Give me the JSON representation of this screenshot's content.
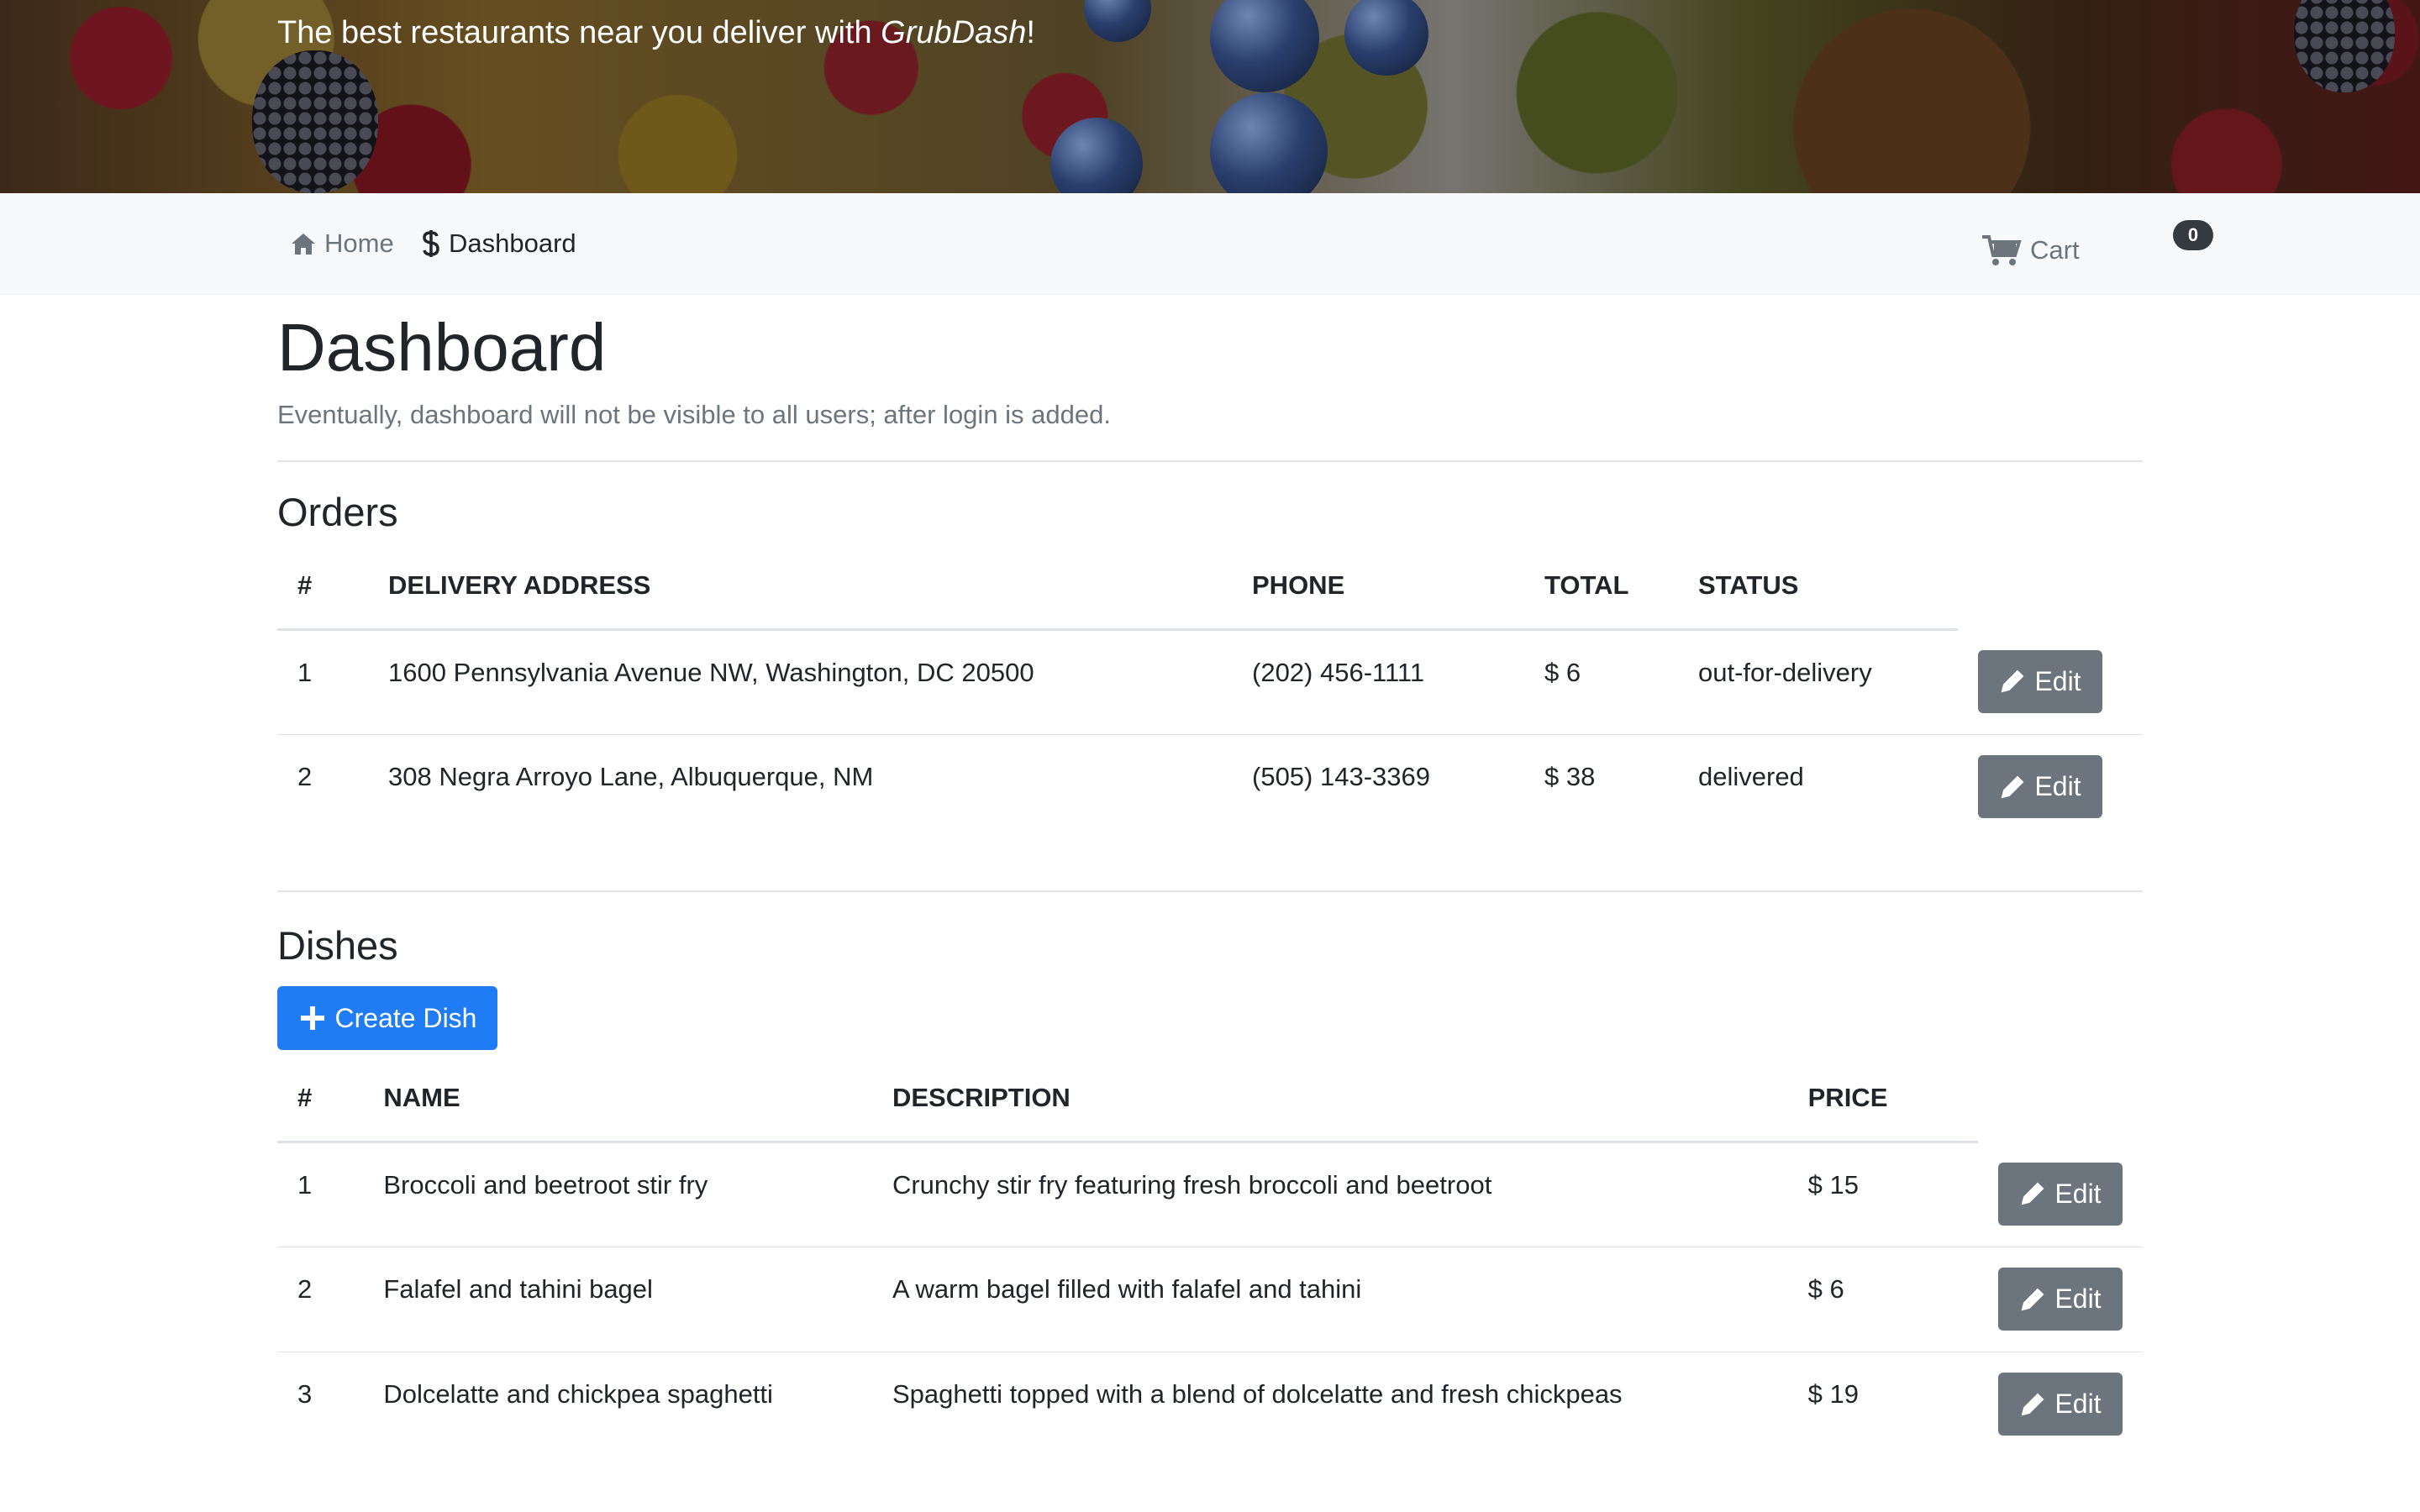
{
  "hero": {
    "text_before": "The best restaurants near you deliver with ",
    "brand": "GrubDash",
    "text_after": "!"
  },
  "nav": {
    "home": {
      "label": "Home",
      "icon": "home-icon"
    },
    "dashboard": {
      "label": "Dashboard",
      "icon": "dollar-icon"
    },
    "cart": {
      "label": "Cart",
      "icon": "cart-icon",
      "count": "0"
    }
  },
  "page": {
    "title": "Dashboard",
    "subtitle": "Eventually, dashboard will not be visible to all users; after login is added."
  },
  "orders": {
    "title": "Orders",
    "columns": [
      "#",
      "DELIVERY ADDRESS",
      "PHONE",
      "TOTAL",
      "STATUS"
    ],
    "rows": [
      {
        "num": "1",
        "address": "1600 Pennsylvania Avenue NW, Washington, DC 20500",
        "phone": "(202) 456-1111",
        "total": "$ 6",
        "status": "out-for-delivery",
        "action": "Edit"
      },
      {
        "num": "2",
        "address": "308 Negra Arroyo Lane, Albuquerque, NM",
        "phone": "(505) 143-3369",
        "total": "$ 38",
        "status": "delivered",
        "action": "Edit"
      }
    ]
  },
  "dishes": {
    "title": "Dishes",
    "create_label": "Create Dish",
    "columns": [
      "#",
      "NAME",
      "DESCRIPTION",
      "PRICE"
    ],
    "rows": [
      {
        "num": "1",
        "name": "Broccoli and beetroot stir fry",
        "description": "Crunchy stir fry featuring fresh broccoli and beetroot",
        "price": "$ 15",
        "action": "Edit"
      },
      {
        "num": "2",
        "name": "Falafel and tahini bagel",
        "description": "A warm bagel filled with falafel and tahini",
        "price": "$ 6",
        "action": "Edit"
      },
      {
        "num": "3",
        "name": "Dolcelatte and chickpea spaghetti",
        "description": "Spaghetti topped with a blend of dolcelatte and fresh chickpeas",
        "price": "$ 19",
        "action": "Edit"
      }
    ]
  },
  "colors": {
    "primary": "#1f7cf4",
    "secondary": "#6c757d",
    "navbar_bg": "#f8f9fa",
    "badge_bg": "#343a40"
  }
}
